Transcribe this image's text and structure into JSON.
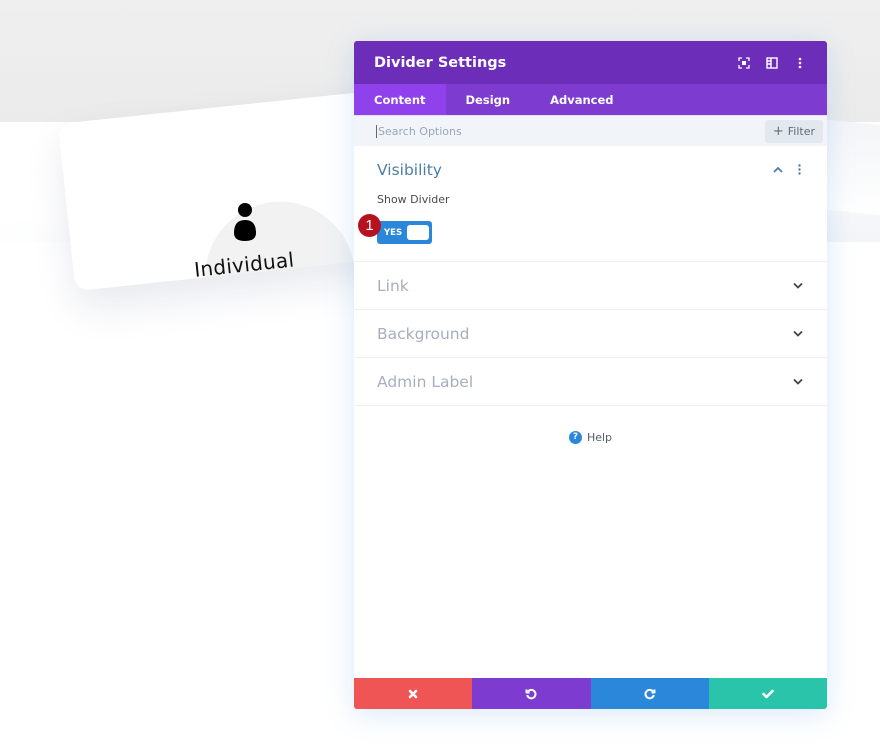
{
  "background": {
    "card": {
      "title": "Individual",
      "icon": "person-icon"
    }
  },
  "modal": {
    "title": "Divider Settings",
    "header_icons": [
      "fullscreen-icon",
      "sidebar-layout-icon",
      "more-vertical-icon"
    ],
    "tabs": [
      {
        "label": "Content",
        "active": true
      },
      {
        "label": "Design",
        "active": false
      },
      {
        "label": "Advanced",
        "active": false
      }
    ],
    "search": {
      "placeholder": "Search Options",
      "value": ""
    },
    "filter_label": "Filter",
    "sections": [
      {
        "title": "Visibility",
        "expanded": true,
        "options": [
          {
            "label": "Show Divider",
            "type": "toggle",
            "value": "YES",
            "on": true
          }
        ]
      },
      {
        "title": "Link",
        "expanded": false
      },
      {
        "title": "Background",
        "expanded": false
      },
      {
        "title": "Admin Label",
        "expanded": false
      }
    ],
    "help_label": "Help",
    "annotation_badge": "1",
    "footer_buttons": [
      {
        "action": "discard",
        "icon": "close-icon",
        "color": "#ef5555"
      },
      {
        "action": "undo",
        "icon": "undo-icon",
        "color": "#7e3bd0"
      },
      {
        "action": "redo",
        "icon": "redo-icon",
        "color": "#2b87da"
      },
      {
        "action": "save",
        "icon": "check-icon",
        "color": "#29c4a9"
      }
    ]
  },
  "colors": {
    "header": "#6c2eb9",
    "tabs": "#7d3bcf",
    "active_tab": "#8f42ec",
    "toggle": "#2b87da",
    "section_open": "#4c7ea6",
    "section_closed": "#a6afba"
  }
}
